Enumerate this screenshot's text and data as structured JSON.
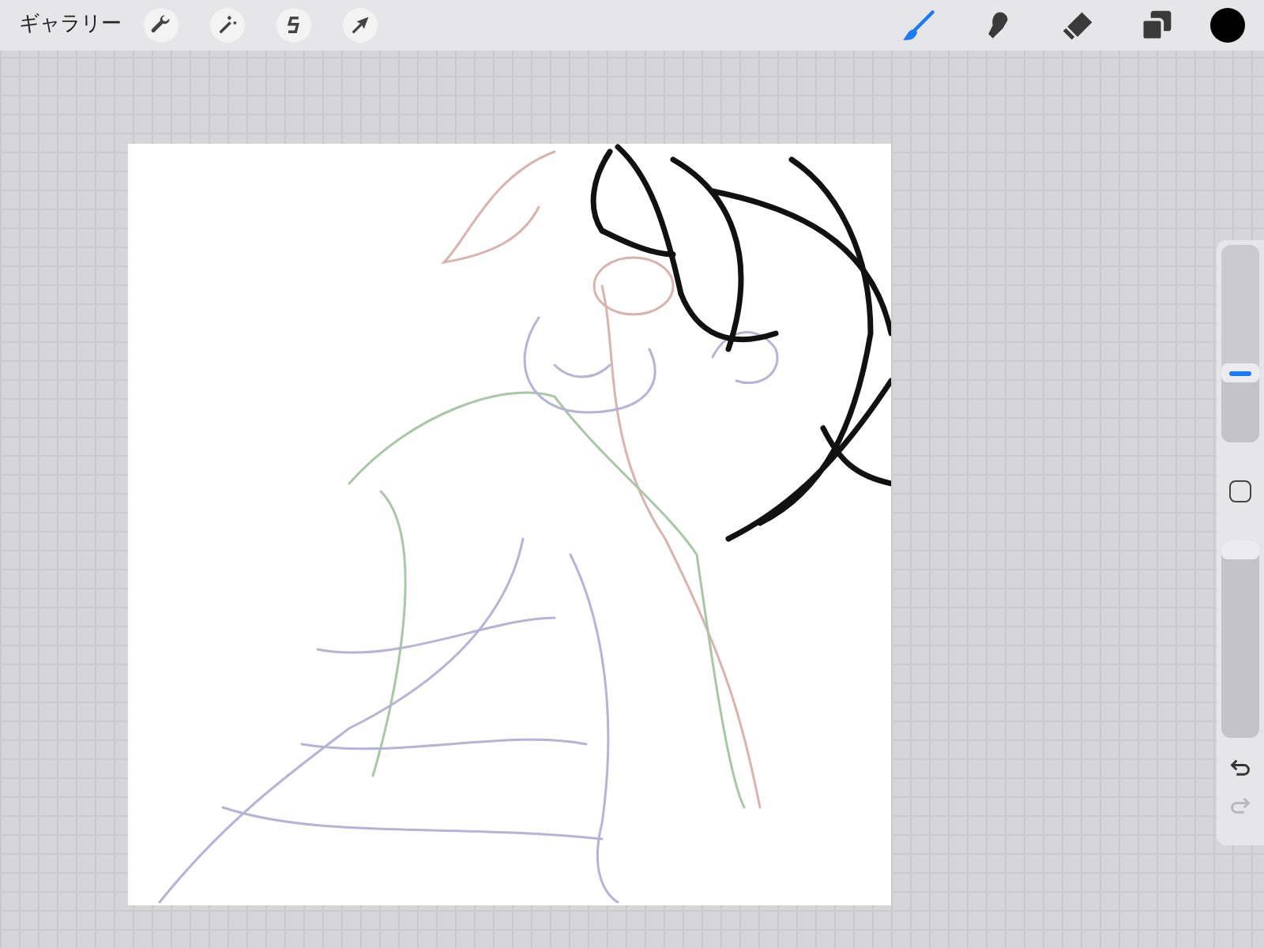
{
  "toolbar": {
    "gallery": "ギャラリー",
    "left_tools": [
      {
        "kind": "wrench",
        "selected": false
      },
      {
        "kind": "wand",
        "selected": false
      },
      {
        "kind": "selection",
        "selected": false
      },
      {
        "kind": "arrow",
        "selected": false
      }
    ],
    "right_tools": [
      {
        "kind": "brush",
        "selected": true
      },
      {
        "kind": "smudge",
        "selected": false
      },
      {
        "kind": "eraser",
        "selected": false
      },
      {
        "kind": "layers",
        "selected": false
      }
    ],
    "color_swatch": {
      "color": "#000000"
    }
  },
  "sidebar": {
    "brush_size": {
      "level": 0.35
    },
    "opacity": {
      "level": 0.95
    },
    "undo": {
      "disabled": false
    },
    "redo": {
      "disabled": true
    }
  }
}
